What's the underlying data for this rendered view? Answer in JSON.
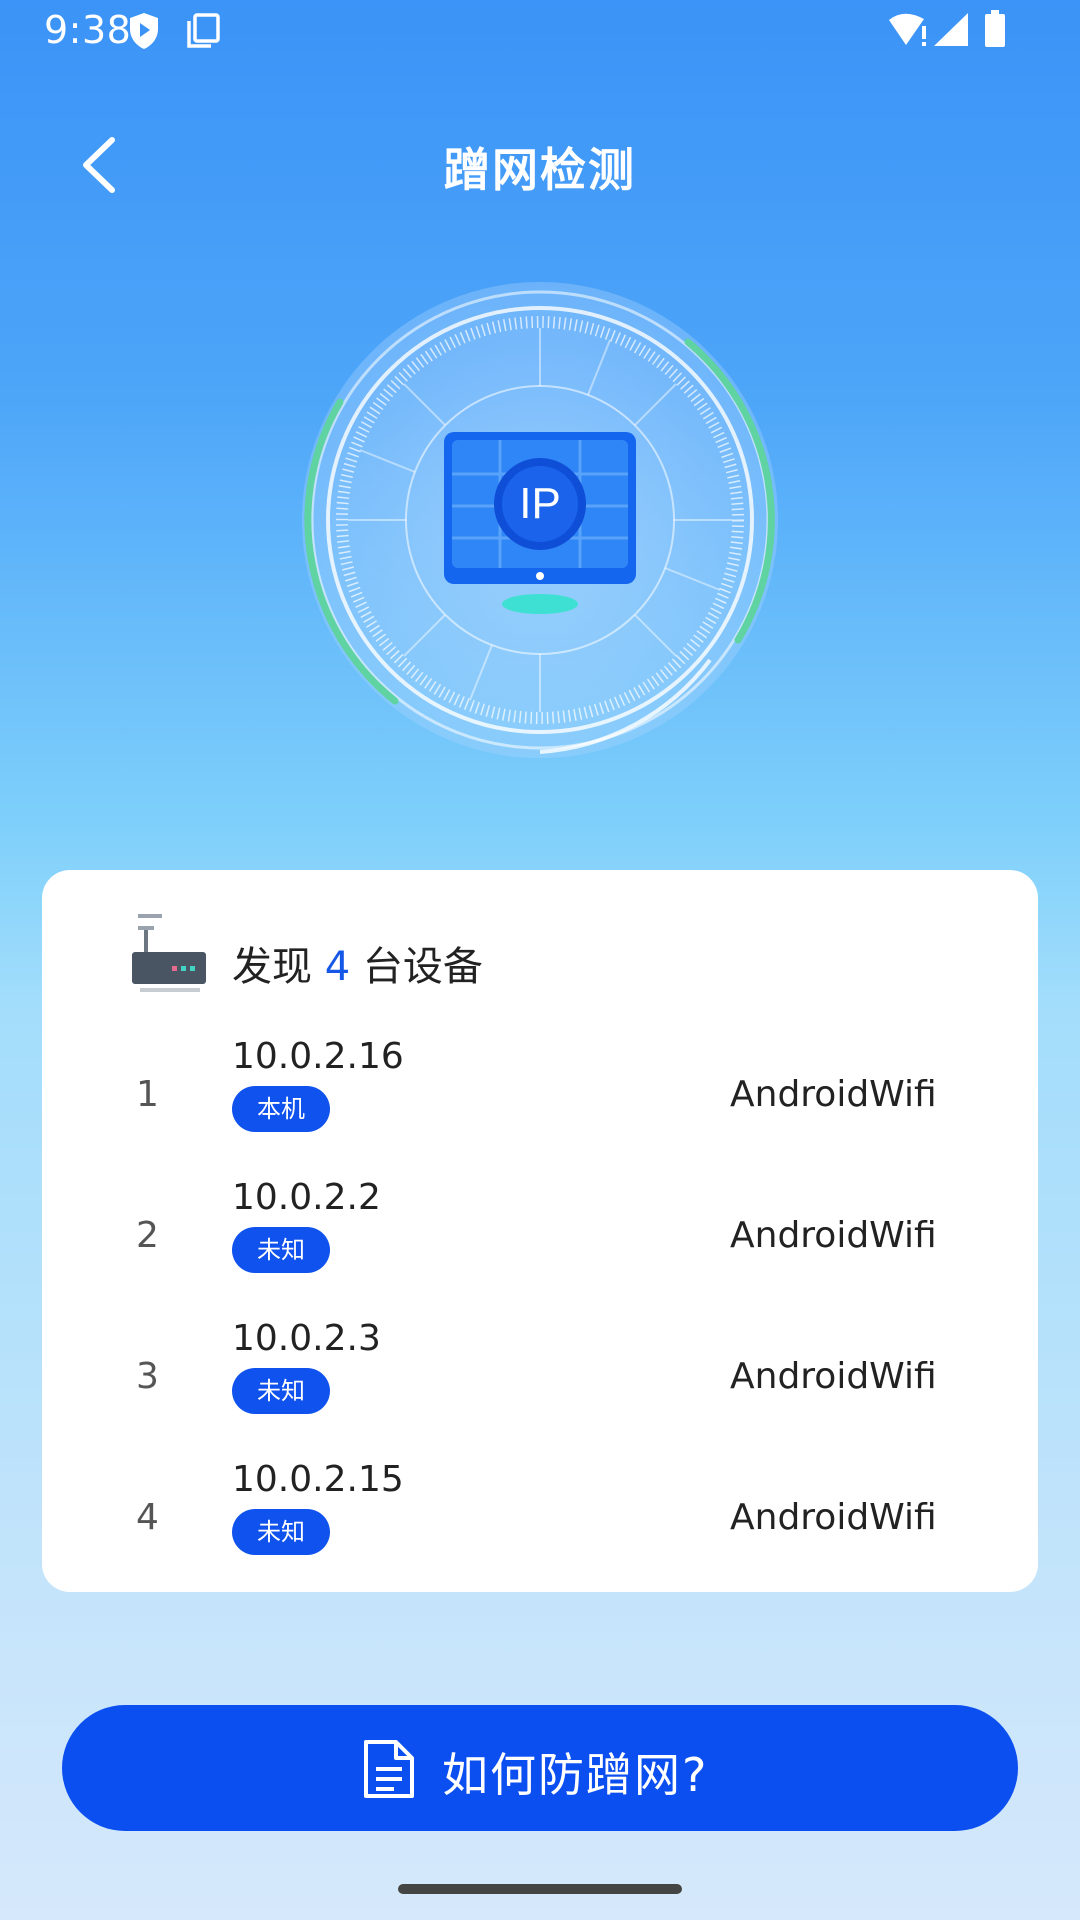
{
  "status_bar": {
    "time": "9:38"
  },
  "header": {
    "title": "蹭网检测"
  },
  "radar": {
    "center_label": "IP"
  },
  "devices": {
    "found_prefix": "发现",
    "count": "4",
    "found_suffix": "台设备",
    "items": [
      {
        "index": "1",
        "ip": "10.0.2.16",
        "tag": "本机",
        "name": "AndroidWifi"
      },
      {
        "index": "2",
        "ip": "10.0.2.2",
        "tag": "未知",
        "name": "AndroidWifi"
      },
      {
        "index": "3",
        "ip": "10.0.2.3",
        "tag": "未知",
        "name": "AndroidWifi"
      },
      {
        "index": "4",
        "ip": "10.0.2.15",
        "tag": "未知",
        "name": "AndroidWifi"
      }
    ]
  },
  "cta": {
    "label": "如何防蹭网?"
  },
  "colors": {
    "primary": "#0c4ff0",
    "badge": "#1052ee",
    "accent_text": "#1557e6",
    "radar_arc": "#5fd3a1"
  }
}
